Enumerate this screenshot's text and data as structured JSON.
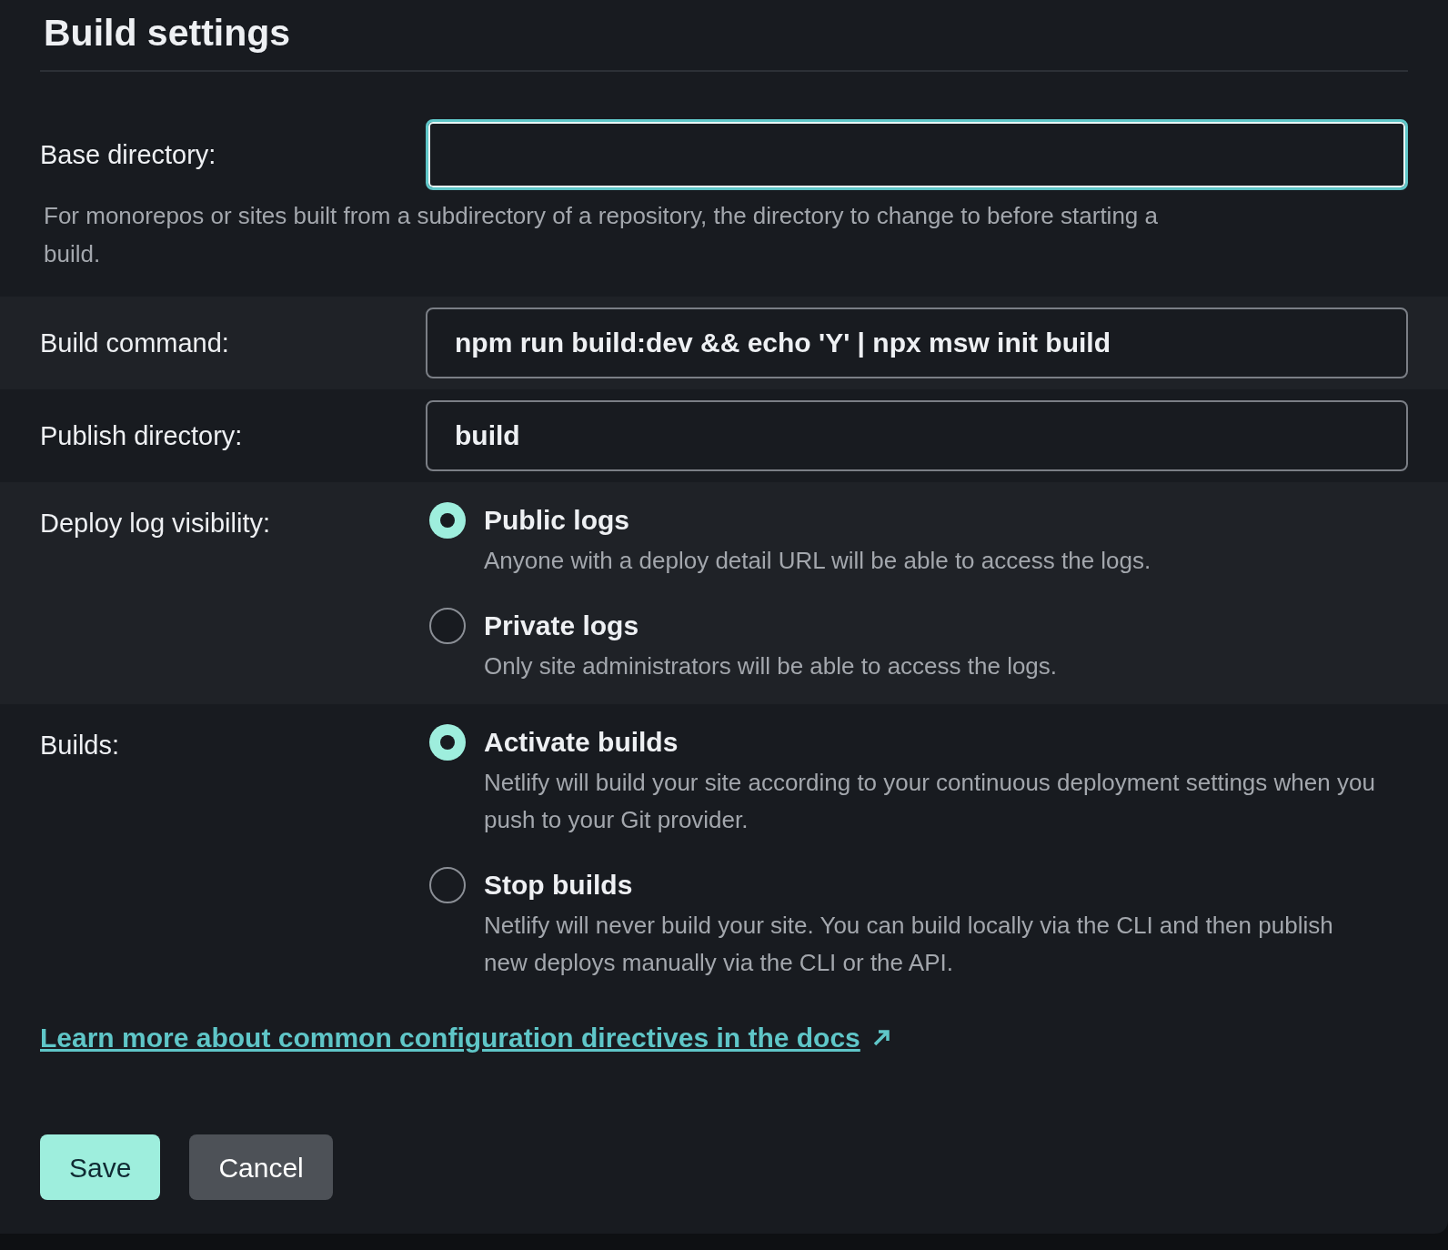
{
  "title": "Build settings",
  "fields": [
    {
      "label": "Base directory:",
      "focused": true,
      "help": "For monorepos or sites built from a subdirectory of a repository, the directory to change to before starting a build."
    },
    {
      "label": "Build command:",
      "value": "npm run build:dev && echo 'Y' | npx msw init build",
      "focused": false
    },
    {
      "label": "Publish directory:",
      "value": "build",
      "focused": false
    }
  ],
  "radio_groups": [
    {
      "label": "Deploy log visibility:",
      "options": [
        {
          "title": "Public logs",
          "description": "Anyone with a deploy detail URL will be able to access the logs.",
          "selected": true
        },
        {
          "title": "Private logs",
          "description": "Only site administrators will be able to access the logs.",
          "selected": false
        }
      ]
    },
    {
      "label": "Builds:",
      "options": [
        {
          "title": "Activate builds",
          "description": "Netlify will build your site according to your continuous deployment settings when you push to your Git provider.",
          "selected": true
        },
        {
          "title": "Stop builds",
          "description": "Netlify will never build your site. You can build locally via the CLI and then publish new deploys manually via the CLI or the API.",
          "selected": false
        }
      ]
    }
  ],
  "docs_link": "Learn more about common configuration directives in the docs",
  "buttons": [
    {
      "label": "Save",
      "kind": "primary"
    },
    {
      "label": "Cancel",
      "kind": "secondary"
    }
  ]
}
